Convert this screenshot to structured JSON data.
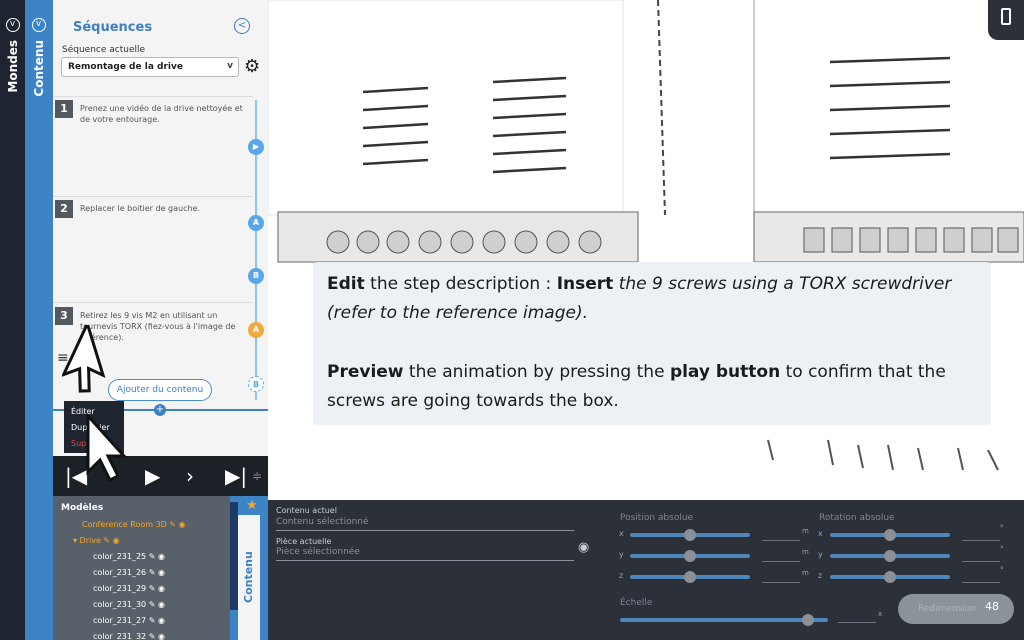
{
  "tabs": {
    "mondes": "Mondes",
    "contenu": "Contenu"
  },
  "sequences": {
    "title": "Séquences",
    "current_label": "Séquence actuelle",
    "current_value": "Remontage de la drive",
    "steps": [
      {
        "num": "1",
        "text": "Prenez une vidéo de la drive nettoyée et de votre entourage."
      },
      {
        "num": "2",
        "text": "Replacer le boitier de gauche."
      },
      {
        "num": "3",
        "text": "Retirez les 9 vis M2 en utilisant un tournevis TORX (fiez-vous à l'image de référence)."
      }
    ],
    "timeline_markers": [
      "A",
      "B",
      "A",
      "B"
    ],
    "add_content": "Ajouter du contenu"
  },
  "context_menu": {
    "items": [
      "Éditer",
      "Dupliquer",
      "Supprimer"
    ],
    "visible": [
      "Éditer",
      "Dup",
      "ier",
      "Sup"
    ]
  },
  "models": {
    "title": "Modèles",
    "items": [
      {
        "label": "Conference Room 3D",
        "color": "#f5a623",
        "indent": 1
      },
      {
        "label": "▾ Drive",
        "color": "#f5a623",
        "indent": 0
      },
      {
        "label": "color_231_25",
        "color": "#ffffff",
        "indent": 2
      },
      {
        "label": "color_231_26",
        "color": "#ffffff",
        "indent": 2
      },
      {
        "label": "color_231_29",
        "color": "#ffffff",
        "indent": 2
      },
      {
        "label": "color_231_30",
        "color": "#ffffff",
        "indent": 2
      },
      {
        "label": "color_231_27",
        "color": "#ffffff",
        "indent": 2
      },
      {
        "label": "color_231_32",
        "color": "#ffffff",
        "indent": 2
      }
    ],
    "dynamic_tab": "Contenu Dynamique"
  },
  "properties": {
    "current_content_label": "Contenu actuel",
    "current_content_value": "Contenu sélectionné",
    "current_piece_label": "Pièce actuelle",
    "current_piece_value": "Pièce sélectionnée",
    "position_label": "Position absolue",
    "rotation_label": "Rotation absolue",
    "scale_label": "Échelle",
    "axes": [
      "x",
      "y",
      "z"
    ],
    "pos_unit": "m",
    "rot_unit": "°",
    "scale_unit": "x",
    "resize_button": "Redimension",
    "page_number": "48"
  },
  "overlay": {
    "p1_bold1": "Edit",
    "p1_text1": " the step description : ",
    "p1_bold2": "Insert",
    "p1_italic": " the 9 screws using a TORX screwdriver (refer to the reference image).",
    "p2_bold1": "Preview",
    "p2_text1": " the animation by pressing the ",
    "p2_bold2": "play button",
    "p2_text2": " to confirm that the screws are going towards the box."
  },
  "colors": {
    "accent_blue": "#3d84c6",
    "dark": "#1f2530",
    "orange": "#f5a623"
  }
}
